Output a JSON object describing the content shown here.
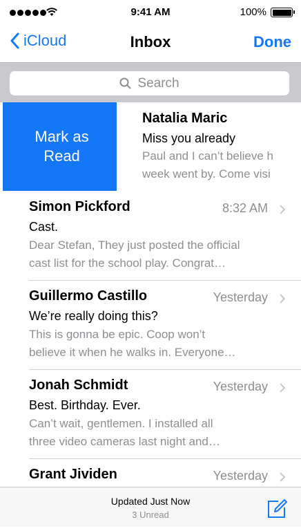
{
  "status_bar": {
    "time": "9:41 AM",
    "battery_percent": "100%",
    "signal_bars": 5,
    "icons": [
      "signal-icon",
      "wifi-icon",
      "battery-icon"
    ]
  },
  "nav": {
    "back_label": "iCloud",
    "title": "Inbox",
    "done_label": "Done"
  },
  "search": {
    "placeholder": "Search"
  },
  "swipe_action": {
    "label": "Mark as Read",
    "color": "#1477f8"
  },
  "messages": [
    {
      "sender": "Natalia Maric",
      "subject": "Miss you already",
      "preview_line1": "Paul and I can’t believe h",
      "preview_line2": "week went by. Come visi"
    },
    {
      "sender": "Simon Pickford",
      "time": "8:32 AM",
      "subject": "Cast.",
      "preview_line1": "Dear Stefan, They just posted the official",
      "preview_line2": "cast list for the school play. Congrat…"
    },
    {
      "sender": "Guillermo Castillo",
      "time": "Yesterday",
      "subject": "We’re really doing this?",
      "preview_line1": "This is gonna be epic. Coop won’t",
      "preview_line2": "believe it when he walks in. Everyone…"
    },
    {
      "sender": "Jonah Schmidt",
      "time": "Yesterday",
      "subject": "Best. Birthday. Ever.",
      "preview_line1": "Can’t wait, gentlemen. I installed all",
      "preview_line2": "three video cameras last night and…"
    },
    {
      "sender": "Grant Jividen",
      "time": "Yesterday"
    }
  ],
  "toolbar": {
    "updated_label": "Updated Just Now",
    "unread_label": "3 Unread"
  },
  "colors": {
    "accent": "#1477f8",
    "secondary_text": "#8e8e93",
    "search_background": "#c9c9ce"
  }
}
